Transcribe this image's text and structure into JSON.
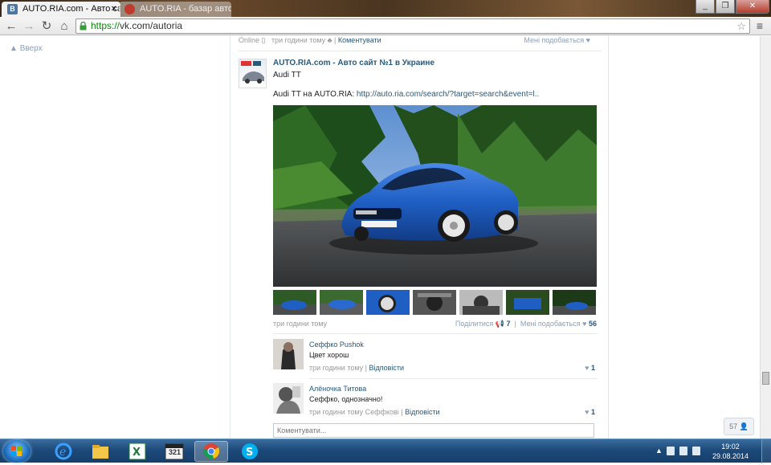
{
  "browser": {
    "tabs": [
      {
        "label": "AUTO.RIA.com - Авто сай",
        "favicon": "В",
        "active": true
      },
      {
        "label": "AUTO.RIA - базар авто N",
        "favicon": "",
        "active": false
      }
    ],
    "url_scheme": "https://",
    "url_rest": "vk.com/autoria"
  },
  "page": {
    "up_link": "Вверх",
    "prev_post": {
      "status": "Online",
      "time": "три години тому",
      "comment_link": "Коментувати",
      "like_label": "Мені подобається"
    },
    "post": {
      "author": "AUTO.RIA.com - Авто сайт №1 в Украине",
      "title": "Audi TT",
      "text_prefix": "Audi TT на AUTO.RIA: ",
      "link": "http://auto.ria.com/search/?target=search&event=l..",
      "time": "три години тому",
      "share_label": "Поділитися",
      "share_count": "7",
      "like_label": "Мені подобається",
      "like_count": "56"
    },
    "comments": [
      {
        "name": "Сеффко Pushok",
        "text": "Цвет хорош",
        "time": "три години тому",
        "reply": "Відповісти",
        "likes": "1"
      },
      {
        "name": "Алёночка Титова",
        "text": "Сеффко, однозначно!",
        "time": "три години тому Сеффкові",
        "reply": "Відповісти",
        "likes": "1"
      }
    ],
    "reply_placeholder": "Коментувати...",
    "online_count": "57"
  },
  "taskbar": {
    "time": "19:02",
    "date": "29.08.2014",
    "calendar_number": "321"
  },
  "colors": {
    "link": "#2b587a",
    "car_blue": "#1f5fc4",
    "taskbar": "#1d4a7a"
  }
}
